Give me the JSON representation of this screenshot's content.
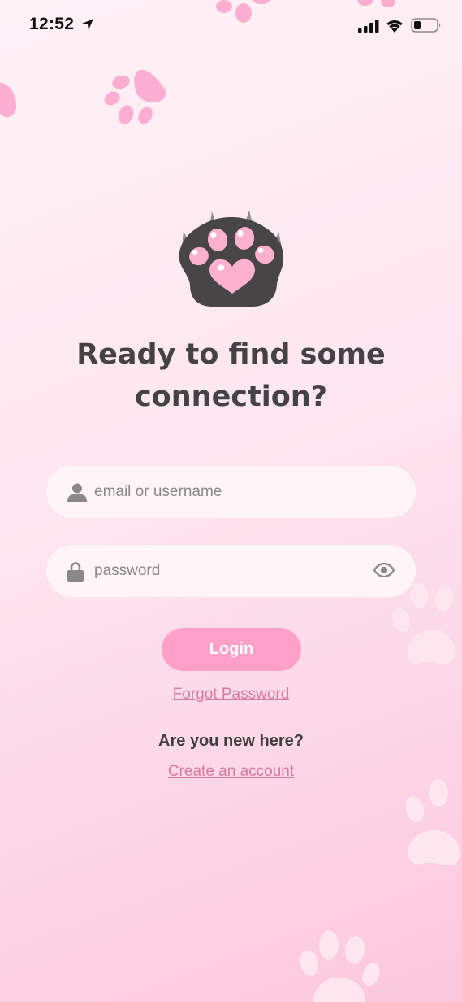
{
  "status_bar": {
    "time": "12:52",
    "icons": [
      "location-arrow-icon",
      "cellular-signal-icon",
      "wifi-icon",
      "battery-icon"
    ]
  },
  "login": {
    "headline": "Ready to find some connection?",
    "email_placeholder": "email or username",
    "password_placeholder": "password",
    "login_label": "Login",
    "forgot_password": "Forgot Password",
    "new_here": "Are you new here?",
    "create_account": "Create an account"
  },
  "colors": {
    "accent_pink": "#ffa0c8",
    "link_pink": "#d77aa0",
    "paw_dark": "#474546",
    "paw_pad": "#fdb1cf",
    "text_dark": "#3f3d3e"
  }
}
